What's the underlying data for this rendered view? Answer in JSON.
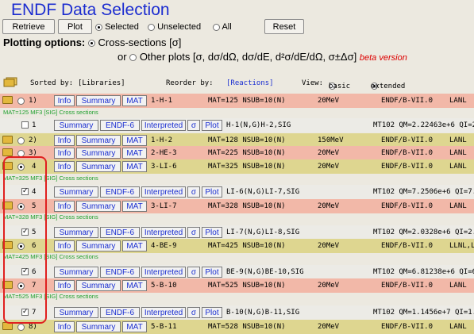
{
  "page": {
    "title": "ENDF Data Selection"
  },
  "toolbar": {
    "retrieve_label": "Retrieve",
    "plot_label": "Plot",
    "selected_label": "Selected",
    "unselected_label": "Unselected",
    "all_label": "All",
    "reset_label": "Reset"
  },
  "plotting": {
    "heading": "Plotting options:",
    "cross_sections": "Cross-sections [σ]",
    "or": "or",
    "other_plots": "Other plots [σ, dσ/dΩ, dσ/dE, d²σ/dE/dΩ, σ±Δσ]",
    "beta": "beta version"
  },
  "sortbar": {
    "sorted_by_label": "Sorted by:",
    "sorted_by_value": "[Libraries]",
    "reorder_label": "Reorder by:",
    "reorder_value": "[Reactions]",
    "view_label": "View:",
    "basic": "basic",
    "extended": "extended"
  },
  "buttons": {
    "info": "Info",
    "summary": "Summary",
    "mat": "MAT",
    "endf6": "ENDF-6",
    "interpreted": "Interpreted",
    "sigma": "σ",
    "plot": "Plot"
  },
  "materials": [
    {
      "num": "1)",
      "nucleus": "1-H-1",
      "mat": "MAT=125 NSUB=10(N)",
      "energy": "20MeV",
      "lib": "ENDF/B-VII.0",
      "lab": "LANL",
      "color": "#f2b8a8",
      "mf_note": "MAT=125 MF3 [SIG] Cross sections"
    },
    {
      "num": "2)",
      "nucleus": "1-H-2",
      "mat": "MAT=128 NSUB=10(N)",
      "energy": "150MeV",
      "lib": "ENDF/B-VII.0",
      "lab": "LANL",
      "color": "#ded690"
    },
    {
      "num": "3)",
      "nucleus": "2-HE-3",
      "mat": "MAT=225 NSUB=10(N)",
      "energy": "20MeV",
      "lib": "ENDF/B-VII.0",
      "lab": "LANL",
      "color": "#f2b8a8"
    },
    {
      "num": "4",
      "nucleus": "3-LI-6",
      "mat": "MAT=325 NSUB=10(N)",
      "energy": "20MeV",
      "lib": "ENDF/B-VII.0",
      "lab": "LANL",
      "color": "#ded690",
      "mf_note": "MAT=325 MF3 [SIG] Cross sections"
    },
    {
      "num": "5",
      "nucleus": "3-LI-7",
      "mat": "MAT=328 NSUB=10(N)",
      "energy": "20MeV",
      "lib": "ENDF/B-VII.0",
      "lab": "LANL",
      "color": "#f2b8a8",
      "mf_note": "MAT=328 MF3 [SIG] Cross sections"
    },
    {
      "num": "6",
      "nucleus": "4-BE-9",
      "mat": "MAT=425 NSUB=10(N)",
      "energy": "20MeV",
      "lib": "ENDF/B-VII.0",
      "lab": "LLNL,L",
      "color": "#ded690",
      "mf_note": "MAT=425 MF3 [SIG] Cross sections"
    },
    {
      "num": "7",
      "nucleus": "5-B-10",
      "mat": "MAT=525 NSUB=10(N)",
      "energy": "20MeV",
      "lib": "ENDF/B-VII.0",
      "lab": "LANL",
      "color": "#f2b8a8",
      "mf_note": "MAT=525 MF3 [SIG] Cross sections"
    },
    {
      "num": "8)",
      "nucleus": "5-B-11",
      "mat": "MAT=528 NSUB=10(N)",
      "energy": "20MeV",
      "lib": "ENDF/B-VII.0",
      "lab": "LANL",
      "color": "#ded690"
    }
  ],
  "sections": [
    {
      "index": "1",
      "reaction": "H-1(N,G)H-2,SIG",
      "details": "MT102 QM=2.22463e+6 QI=2"
    },
    {
      "index": "4",
      "reaction": "LI-6(N,G)LI-7,SIG",
      "details": "MT102 QM=7.2506e+6 QI=7."
    },
    {
      "index": "5",
      "reaction": "LI-7(N,G)LI-8,SIG",
      "details": "MT102 QM=2.0328e+6 QI=2."
    },
    {
      "index": "6",
      "reaction": "BE-9(N,G)BE-10,SIG",
      "details": "MT102 QM=6.81238e+6 QI=6"
    },
    {
      "index": "7",
      "reaction": "B-10(N,G)B-11,SIG",
      "details": "MT102 QM=1.1456e+7 QI=1."
    }
  ],
  "colors": {
    "pink": "#f2b8a8",
    "yellow": "#ded690",
    "title_blue": "#1c2dd0",
    "link_blue": "#1b2fd1",
    "mf_green": "#1e9f2d",
    "highlight_red": "#e02020"
  }
}
